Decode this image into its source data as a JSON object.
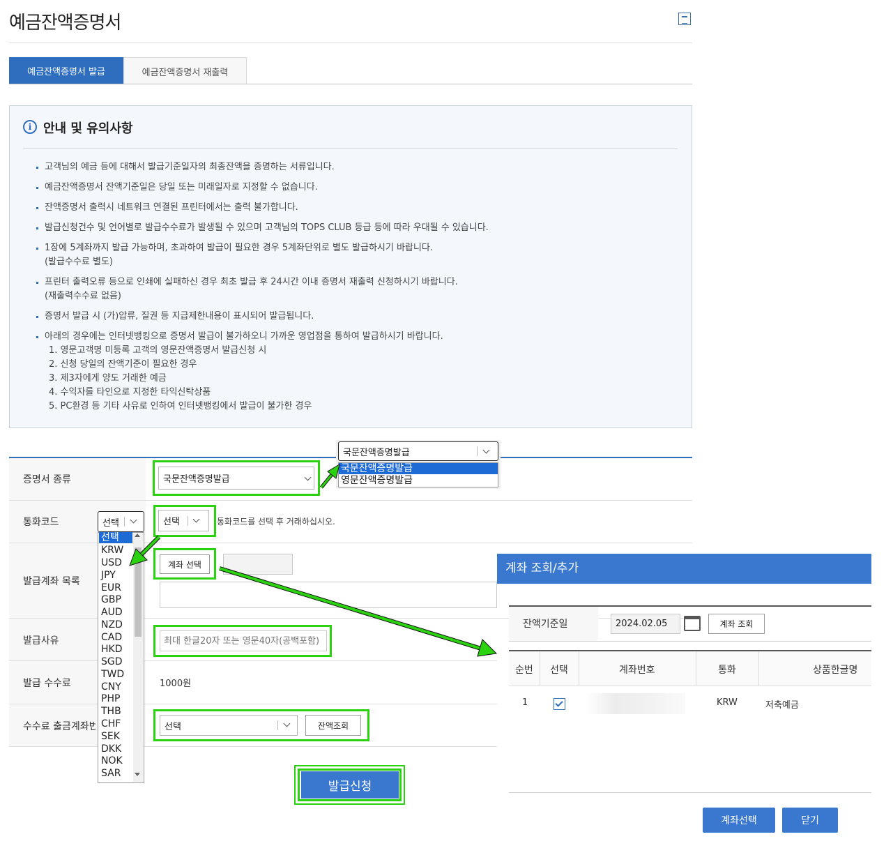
{
  "page": {
    "title": "예금잔액증명서"
  },
  "tabs": [
    {
      "label": "예금잔액증명서 발급"
    },
    {
      "label": "예금잔액증명서 재출력"
    }
  ],
  "notice": {
    "icon_glyph": "i",
    "title": "안내 및 유의사항",
    "items": [
      {
        "text": "고객님의 예금 등에 대해서 발급기준일자의 최종잔액을 증명하는 서류입니다."
      },
      {
        "text": "예금잔액증명서 잔액기준일은 당일 또는 미래일자로 지정할 수 없습니다."
      },
      {
        "text": "잔액증명서 출력시 네트워크 연결된 프린터에서는 출력 불가합니다."
      },
      {
        "text": "발급신청건수 및 언어별로 발급수수료가 발생될 수 있으며 고객님의 TOPS CLUB 등급 등에 따라 우대될 수 있습니다."
      },
      {
        "text": "1장에 5계좌까지 발급 가능하며, 초과하여 발급이 필요한 경우 5계좌단위로 별도 발급하시기 바랍니다.",
        "sub": "(발급수수료 별도)"
      },
      {
        "text": "프린터 출력오류 등으로 인쇄에 실패하신 경우 최초 발급 후 24시간 이내 증명서 재출력 신청하시기 바랍니다.",
        "sub": "(재출력수수료 없음)"
      },
      {
        "text": "증명서 발급 시 (가)압류, 질권 등 지급제한내용이 표시되어 발급됩니다."
      },
      {
        "text": "아래의 경우에는 인터넷뱅킹으로 증명서 발급이 불가하오니 가까운 영업점을 통하여 발급하시기 바랍니다.",
        "numbered": [
          "1. 영문고객명 미등록 고객의 영문잔액증명서 발급신청 시",
          "2. 신청 당일의 잔액기준이 필요한 경우",
          "3. 제3자에게 양도 거래한 예금",
          "4. 수익자를 타인으로 지정한 타익신탁상품",
          "5. PC환경 등 기타 사유로 인하여 인터넷뱅킹에서 발급이 불가한 경우"
        ]
      }
    ]
  },
  "form": {
    "cert_type": {
      "label": "증명서 종류",
      "value": "국문잔액증명발급",
      "popup_value": "국문잔액증명발급",
      "options": [
        "국문잔액증명발급",
        "영문잔액증명발급"
      ]
    },
    "currency": {
      "label": "통화코드",
      "value": "선택",
      "hint": "통화코드를 선택 후 거래하십시오.",
      "options": [
        "선택",
        "KRW",
        "USD",
        "JPY",
        "EUR",
        "GBP",
        "AUD",
        "NZD",
        "CAD",
        "HKD",
        "SGD",
        "TWD",
        "CNY",
        "PHP",
        "THB",
        "CHF",
        "SEK",
        "DKK",
        "NOK",
        "SAR"
      ]
    },
    "accounts": {
      "label": "발급계좌 목록",
      "select_button": "계좌 선택"
    },
    "reason": {
      "label": "발급사유",
      "placeholder": "최대 한글20자 또는 영문40자(공백포함)"
    },
    "fee": {
      "label": "발급 수수료",
      "value": "1000원"
    },
    "fee_account": {
      "label": "수수료 출금계좌번",
      "value": "선택",
      "balance_button": "잔액조회"
    },
    "submit": "발급신청"
  },
  "popup": {
    "title": "계좌 조회/추가",
    "date_label": "잔액기준일",
    "date_value": "2024.02.05",
    "search_button": "계좌 조회",
    "columns": [
      "순번",
      "선택",
      "계좌번호",
      "통화",
      "상품한글명"
    ],
    "rows": [
      {
        "no": "1",
        "checked": true,
        "account": "",
        "currency": "KRW",
        "product": "저축예금"
      }
    ],
    "confirm_button": "계좌선택",
    "close_button": "닫기"
  },
  "colors": {
    "accent": "#2f6dbf",
    "highlight": "#2bd20f",
    "popup_header": "#3a78d0"
  }
}
